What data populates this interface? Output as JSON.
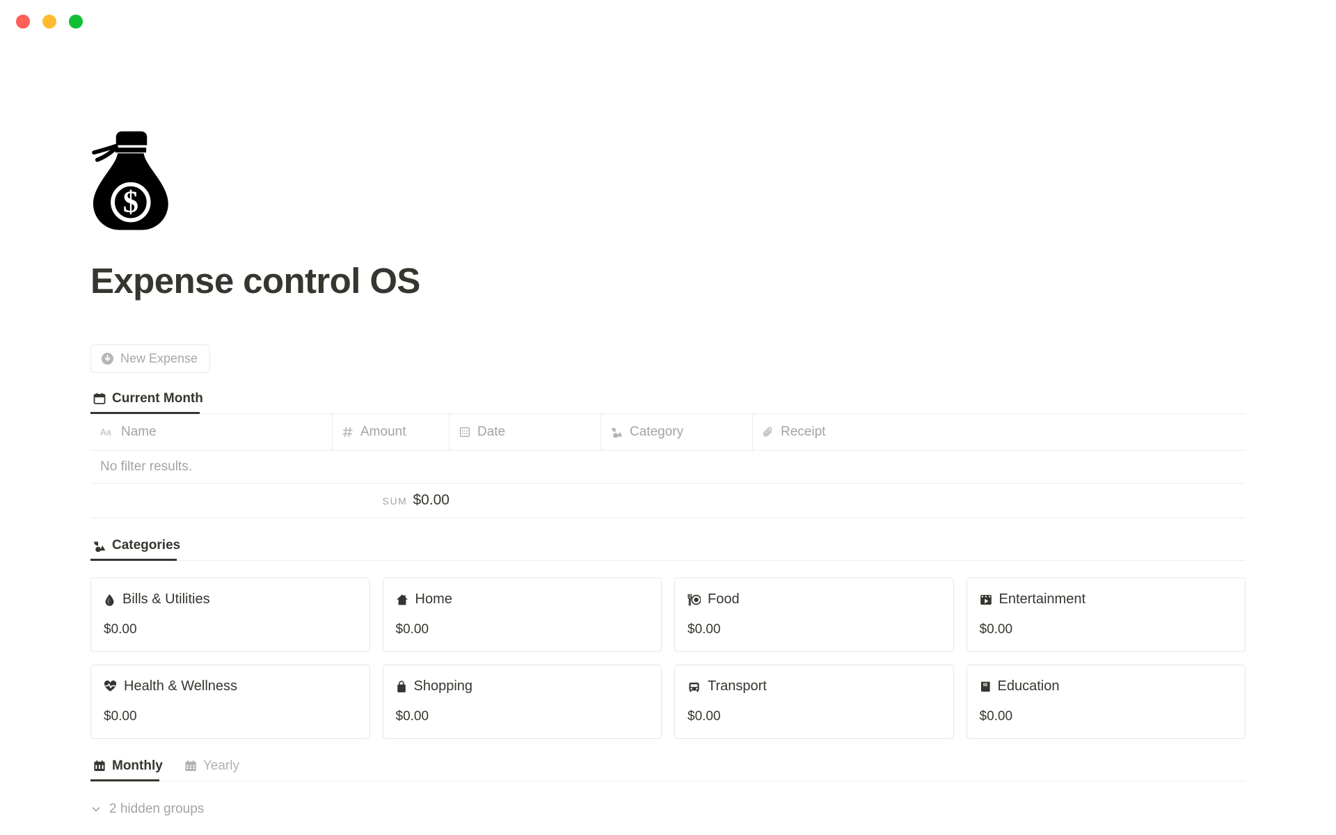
{
  "window": {
    "controls": [
      {
        "name": "close",
        "color": "#ff5f57"
      },
      {
        "name": "minimize",
        "color": "#febc2e"
      },
      {
        "name": "maximize",
        "color": "#0fc034"
      }
    ]
  },
  "page": {
    "icon": "money-bag-icon",
    "title": "Expense control OS"
  },
  "toolbar": {
    "new_expense_label": "New Expense",
    "new_expense_icon": "arrow-down-circle-icon"
  },
  "database_tabs": [
    {
      "label": "Current Month",
      "icon": "calendar-icon",
      "active": true
    }
  ],
  "table": {
    "columns": [
      {
        "label": "Name",
        "icon": "text-aa-icon"
      },
      {
        "label": "Amount",
        "icon": "number-hash-icon"
      },
      {
        "label": "Date",
        "icon": "calendar-small-icon"
      },
      {
        "label": "Category",
        "icon": "relation-icon"
      },
      {
        "label": "Receipt",
        "icon": "paperclip-icon"
      }
    ],
    "empty_message": "No filter results.",
    "sum_label": "SUM",
    "sum_value": "$0.00"
  },
  "categories_tabs": [
    {
      "label": "Categories",
      "icon": "relation-icon",
      "active": true
    }
  ],
  "categories": [
    {
      "label": "Bills & Utilities",
      "icon": "droplet-icon",
      "amount": "$0.00"
    },
    {
      "label": "Home",
      "icon": "house-icon",
      "amount": "$0.00"
    },
    {
      "label": "Food",
      "icon": "fork-plate-icon",
      "amount": "$0.00"
    },
    {
      "label": "Entertainment",
      "icon": "film-icon",
      "amount": "$0.00"
    },
    {
      "label": "Health & Wellness",
      "icon": "heartbeat-icon",
      "amount": "$0.00"
    },
    {
      "label": "Shopping",
      "icon": "shopping-bag-icon",
      "amount": "$0.00"
    },
    {
      "label": "Transport",
      "icon": "bus-icon",
      "amount": "$0.00"
    },
    {
      "label": "Education",
      "icon": "book-icon",
      "amount": "$0.00"
    }
  ],
  "period_tabs": [
    {
      "label": "Monthly",
      "icon": "calendar-month-icon",
      "active": true
    },
    {
      "label": "Yearly",
      "icon": "calendar-year-icon",
      "active": false
    }
  ],
  "hidden_groups": {
    "label": "2 hidden groups",
    "icon": "chevron-down-icon"
  }
}
